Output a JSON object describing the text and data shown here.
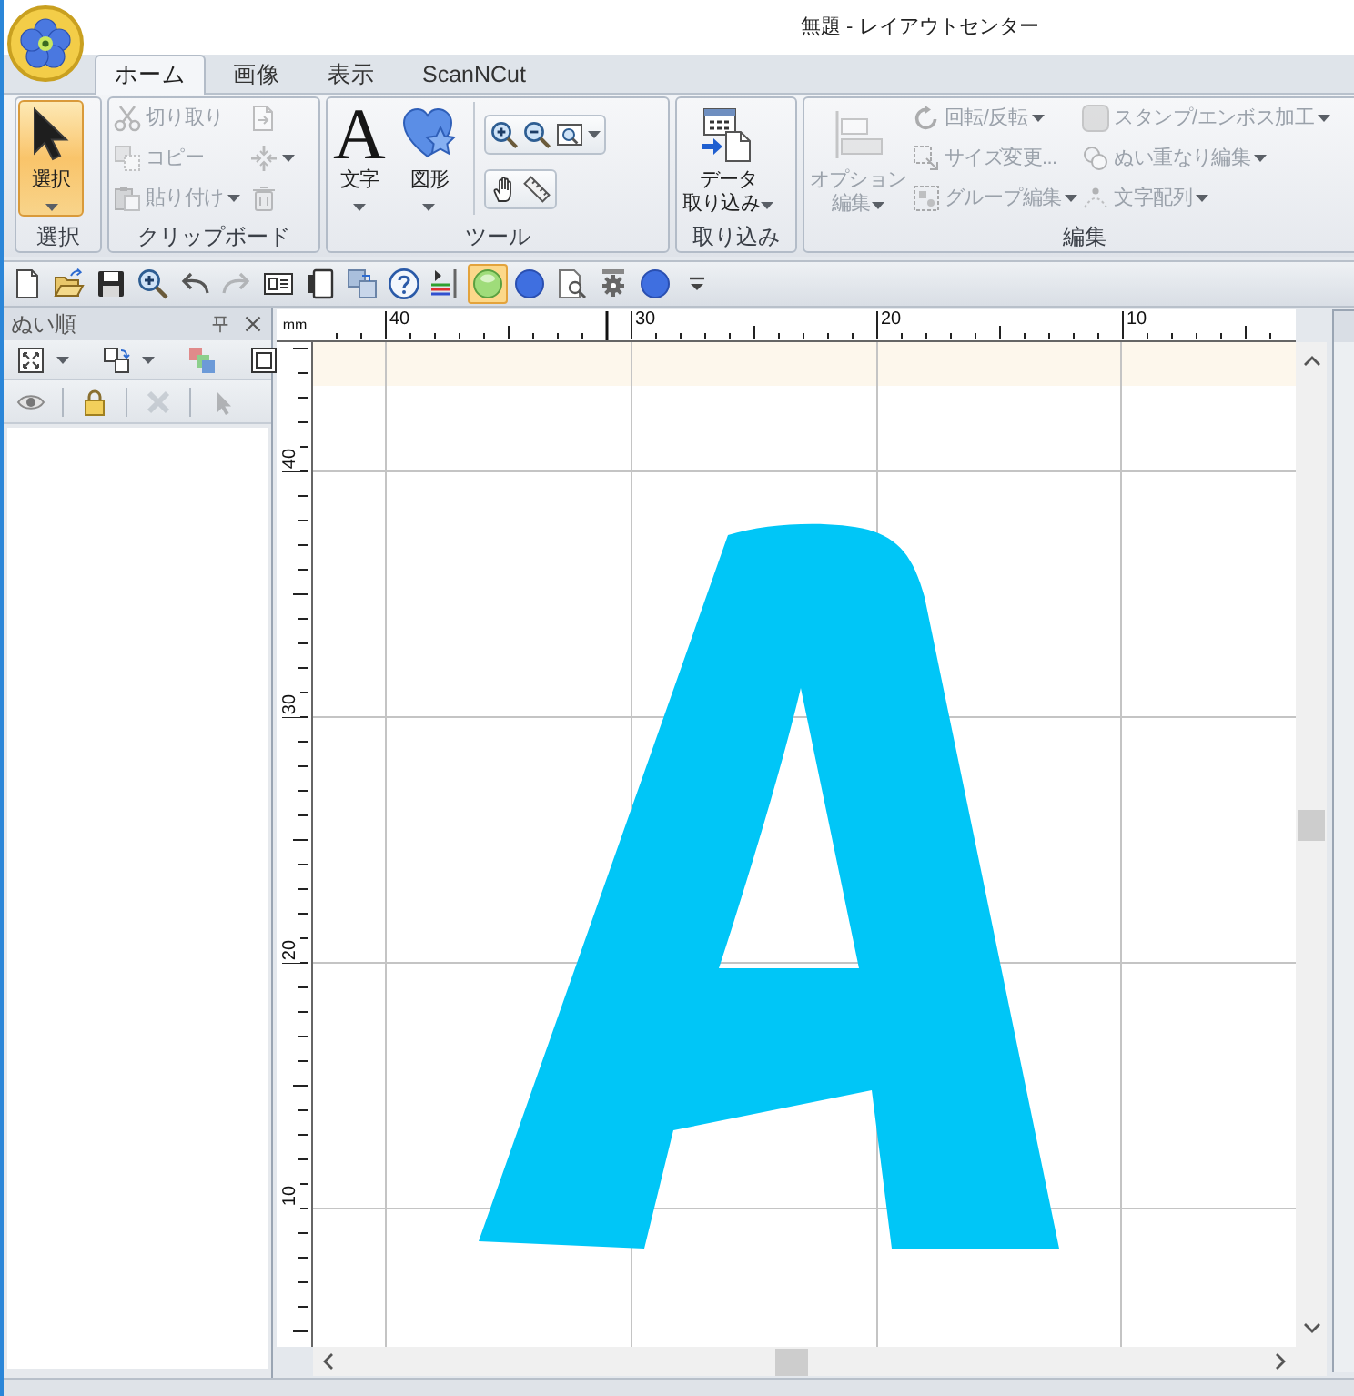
{
  "window": {
    "title": "無題 - レイアウトセンター"
  },
  "tabs": [
    {
      "label": "ホーム",
      "selected": true
    },
    {
      "label": "画像",
      "selected": false
    },
    {
      "label": "表示",
      "selected": false
    },
    {
      "label": "ScanNCut",
      "selected": false
    }
  ],
  "ribbon": [
    {
      "label": "選択",
      "columns": [
        {
          "kind": "stack",
          "buttons": [
            {
              "kind": "large",
              "lines": [
                "選択"
              ],
              "selected": true,
              "disabled": false,
              "dropdown": true
            }
          ]
        }
      ]
    },
    {
      "label": "クリップボード",
      "columns": [
        {
          "kind": "stack",
          "buttons": [
            {
              "kind": "small",
              "label": "切り取り",
              "disabled": true,
              "dropdown": false
            },
            {
              "kind": "small",
              "label": "コピー",
              "disabled": true,
              "dropdown": false
            },
            {
              "kind": "small",
              "label": "貼り付け",
              "disabled": true,
              "dropdown": true
            }
          ]
        },
        {
          "kind": "stack",
          "buttons": [
            {
              "kind": "icon",
              "disabled": true,
              "dropdown": false
            },
            {
              "kind": "icon",
              "disabled": true,
              "dropdown": true
            },
            {
              "kind": "icon",
              "disabled": true,
              "dropdown": false
            }
          ]
        }
      ]
    },
    {
      "label": "ツール",
      "columns": [
        {
          "kind": "stack",
          "buttons": [
            {
              "kind": "large",
              "glyph": "A",
              "lines": [
                "文字"
              ],
              "selected": false,
              "disabled": false,
              "dropdown": true
            }
          ]
        },
        {
          "kind": "stack",
          "buttons": [
            {
              "kind": "large",
              "lines": [
                "図形"
              ],
              "selected": false,
              "disabled": false,
              "dropdown": true
            }
          ]
        },
        {
          "kind": "strips",
          "strips": [
            {
              "buttons": [
                {
                  "kind": "icon",
                  "disabled": false,
                  "dropdown": false
                },
                {
                  "kind": "icon",
                  "disabled": false,
                  "dropdown": false
                },
                {
                  "kind": "icon",
                  "disabled": false,
                  "dropdown": true
                }
              ]
            },
            {
              "buttons": [
                {
                  "kind": "icon",
                  "disabled": false,
                  "dropdown": false
                },
                {
                  "kind": "icon",
                  "disabled": false,
                  "dropdown": false
                }
              ]
            }
          ]
        }
      ]
    },
    {
      "label": "取り込み",
      "columns": [
        {
          "kind": "stack",
          "buttons": [
            {
              "kind": "large",
              "lines": [
                "データ",
                "取り込み"
              ],
              "selected": false,
              "disabled": false,
              "dropdown": true
            }
          ]
        }
      ]
    },
    {
      "label": "編集",
      "columns": [
        {
          "kind": "stack",
          "buttons": [
            {
              "kind": "large",
              "lines": [
                "オプション",
                "編集"
              ],
              "selected": false,
              "disabled": true,
              "dropdown": true
            }
          ]
        },
        {
          "kind": "stack",
          "buttons": [
            {
              "kind": "small",
              "label": "回転/反転",
              "disabled": true,
              "dropdown": true
            },
            {
              "kind": "small",
              "label": "サイズ変更...",
              "disabled": true,
              "dropdown": false
            },
            {
              "kind": "small",
              "label": "グループ編集",
              "disabled": true,
              "dropdown": true
            }
          ]
        },
        {
          "kind": "stack",
          "buttons": [
            {
              "kind": "small",
              "label": "スタンプ/エンボス加工",
              "disabled": true,
              "dropdown": true
            },
            {
              "kind": "small",
              "label": "ぬい重なり編集",
              "disabled": true,
              "dropdown": true
            },
            {
              "kind": "small",
              "label": "文字配列",
              "disabled": true,
              "dropdown": true
            }
          ]
        }
      ]
    }
  ],
  "quick_access": [
    {
      "selected": false,
      "disabled": false
    },
    {
      "selected": false,
      "disabled": false
    },
    {
      "selected": false,
      "disabled": false
    },
    {
      "selected": false,
      "disabled": false
    },
    {
      "selected": false,
      "disabled": false
    },
    {
      "selected": false,
      "disabled": true
    },
    {
      "selected": false,
      "disabled": false
    },
    {
      "selected": false,
      "disabled": false
    },
    {
      "selected": false,
      "disabled": false
    },
    {
      "selected": false,
      "disabled": false
    },
    {
      "selected": false,
      "disabled": false
    },
    {
      "selected": true,
      "disabled": false
    },
    {
      "selected": false,
      "disabled": false
    },
    {
      "selected": false,
      "disabled": false
    },
    {
      "selected": false,
      "disabled": false
    },
    {
      "selected": false,
      "disabled": false
    },
    {
      "selected": false,
      "disabled": false
    }
  ],
  "stitch_panel": {
    "title": "ぬい順",
    "tool_rows": [
      [
        {
          "disabled": false,
          "dropdown": true
        },
        {
          "disabled": false,
          "dropdown": true
        },
        {
          "disabled": false,
          "dropdown": false
        },
        {
          "disabled": false,
          "dropdown": false
        }
      ],
      [
        {
          "disabled": false,
          "dropdown": false
        },
        {
          "disabled": false,
          "dropdown": false
        },
        {
          "disabled": true,
          "dropdown": false
        },
        {
          "disabled": true,
          "dropdown": false
        }
      ]
    ]
  },
  "ruler": {
    "unit": "mm",
    "top_labels": [
      "40",
      "30",
      "20",
      "10"
    ],
    "left_labels": [
      "40",
      "30",
      "20",
      "10"
    ]
  }
}
